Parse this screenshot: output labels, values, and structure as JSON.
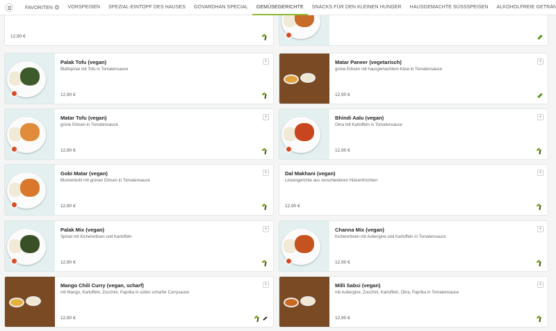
{
  "nav": {
    "tabs": [
      {
        "label": "FAVORITEN 😋"
      },
      {
        "label": "VORSPEISEN"
      },
      {
        "label": "SPEZIAL-EINTOPF DES HAUSES"
      },
      {
        "label": "GOVARDHAN SPECIAL"
      },
      {
        "label": "GEMÜSEGERICHTE",
        "active": true
      },
      {
        "label": "SNACKS FÜR DEN KLEINEN HUNGER"
      },
      {
        "label": "HAUSGEMACHTE SÜSSSPEISEN"
      },
      {
        "label": "ALKOHOLFREIE GETRÄNKE"
      }
    ]
  },
  "items": [
    {
      "title": "",
      "desc": "",
      "price": "12,90 €",
      "diet": [
        "vegan"
      ],
      "img": "none"
    },
    {
      "title": "",
      "desc": "",
      "price": "",
      "diet": [
        "vegetarian"
      ],
      "img": "light"
    },
    {
      "title": "Palak Tofu (vegan)",
      "desc": "Blattspinat mit Tofu in Tomatensauce",
      "price": "12,90 €",
      "diet": [
        "vegan"
      ],
      "img": "light",
      "curry": "#3e5a2a"
    },
    {
      "title": "Matar Paneer (vegetarisch)",
      "desc": "grüne Erbsen mit hausgemachtem Käse in Tomatensauce",
      "price": "12,90 €",
      "diet": [
        "vegetarian"
      ],
      "img": "wood",
      "curry": "#e0a23c"
    },
    {
      "title": "Matar Tofu (vegan)",
      "desc": "grüne Erbsen in Tomatensauce",
      "price": "12,90 €",
      "diet": [
        "vegan"
      ],
      "img": "light",
      "curry": "#e08c3a"
    },
    {
      "title": "Bhindi Aalu (vegan)",
      "desc": "Okra mit Kartoffeln in Tomatensauce",
      "price": "12,90 €",
      "diet": [
        "vegan"
      ],
      "img": "light",
      "curry": "#c8461d"
    },
    {
      "title": "Gobi Matar (vegan)",
      "desc": "Blumenkohl mit grünen Erbsen in Tomatensauce",
      "price": "12,90 €",
      "diet": [
        "vegan"
      ],
      "img": "light",
      "curry": "#d9782d"
    },
    {
      "title": "Dal Makhani (vegan)",
      "desc": "Linsengerichte aus verschiedenen Hülsenfrüchten",
      "price": "12,90 €",
      "diet": [
        "vegan"
      ],
      "img": "none"
    },
    {
      "title": "Palak Mix (vegan)",
      "desc": "Spinat mit Kichererbsen und Kartoffeln",
      "price": "12,90 €",
      "diet": [
        "vegan"
      ],
      "img": "light",
      "curry": "#394f25"
    },
    {
      "title": "Channa Mix (vegan)",
      "desc": "Kichererbsen mit Aubergine und Kartoffeln in Tomatensauce",
      "price": "12,90 €",
      "diet": [
        "vegan"
      ],
      "img": "light",
      "curry": "#c5521f"
    },
    {
      "title": "Mango Chili Curry (vegan, scharf)",
      "desc": "mit Mango, Kartoffeln, Zucchini, Paprika in süßer scharfer Currysauce",
      "price": "12,90 €",
      "diet": [
        "vegan",
        "spicy"
      ],
      "img": "wood",
      "curry": "#e7b03f"
    },
    {
      "title": "Milli Sabsi (vegan)",
      "desc": "mit Aubergine, Zucchini, Kartoffeln, Okra, Paprika in Tomatensauce",
      "price": "12,90 €",
      "diet": [
        "vegan"
      ],
      "img": "wood",
      "curry": "#c9681f"
    }
  ],
  "add_symbol": "+"
}
